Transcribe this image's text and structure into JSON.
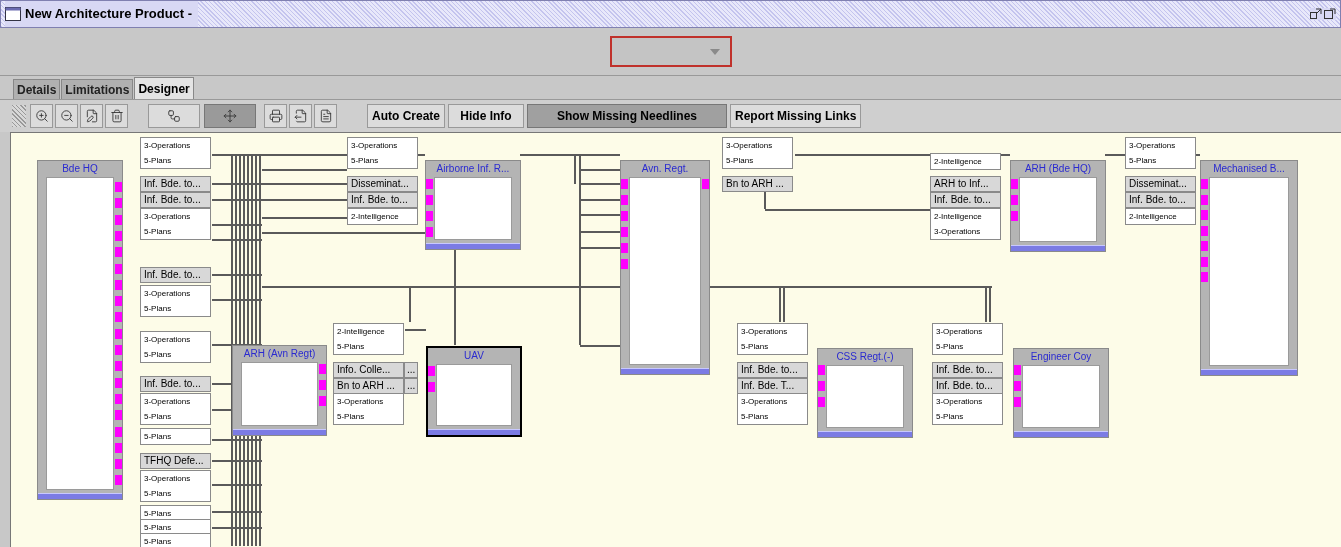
{
  "window": {
    "title": "New Architecture Product -"
  },
  "tabs": [
    {
      "label": "Details",
      "selected": false
    },
    {
      "label": "Limitations",
      "selected": false
    },
    {
      "label": "Designer",
      "selected": true
    }
  ],
  "tools": [
    {
      "kind": "zoom-in",
      "pressed": false
    },
    {
      "kind": "zoom-out",
      "pressed": false
    },
    {
      "kind": "edit",
      "pressed": false
    },
    {
      "kind": "delete",
      "pressed": false
    },
    {
      "kind": "connect",
      "pressed": false
    },
    {
      "kind": "move",
      "pressed": true
    },
    {
      "kind": "print",
      "pressed": false
    },
    {
      "kind": "print-preview",
      "pressed": false
    },
    {
      "kind": "print-setup",
      "pressed": false
    }
  ],
  "buttons": [
    {
      "label": "Auto Create",
      "pressed": false
    },
    {
      "label": "Hide Info",
      "pressed": false
    },
    {
      "label": "Show Missing Needlines",
      "pressed": true
    },
    {
      "label": "Report Missing Links",
      "pressed": false
    }
  ],
  "nodes": [
    {
      "title": "Bde HQ",
      "selected": false
    },
    {
      "title": "Airborne Inf. R...",
      "selected": false
    },
    {
      "title": "Avn. Regt.",
      "selected": false
    },
    {
      "title": "ARH (Bde HQ)",
      "selected": false
    },
    {
      "title": "Mechanised B...",
      "selected": false
    },
    {
      "title": "ARH (Avn Regt)",
      "selected": false
    },
    {
      "title": "UAV",
      "selected": true
    },
    {
      "title": "CSS Regt.(-)",
      "selected": false
    },
    {
      "title": "Engineer Coy",
      "selected": false
    }
  ],
  "labels": [
    {
      "kind": "note",
      "lines": [
        "3-Operations",
        "5-Plans"
      ]
    },
    {
      "kind": "link",
      "text": "Inf. Bde. to..."
    },
    {
      "kind": "link",
      "text": "Inf. Bde. to..."
    },
    {
      "kind": "note",
      "lines": [
        "3-Operations",
        "5-Plans"
      ]
    },
    {
      "kind": "link",
      "text": "Inf. Bde. to..."
    },
    {
      "kind": "note",
      "lines": [
        "3-Operations",
        "5-Plans"
      ]
    },
    {
      "kind": "note",
      "lines": [
        "3-Operations",
        "5-Plans"
      ]
    },
    {
      "kind": "link",
      "text": "Inf. Bde. to..."
    },
    {
      "kind": "note",
      "lines": [
        "3-Operations",
        "5-Plans"
      ]
    },
    {
      "kind": "note",
      "lines": [
        "5-Plans"
      ]
    },
    {
      "kind": "link",
      "text": "TFHQ Defe..."
    },
    {
      "kind": "note",
      "lines": [
        "3-Operations",
        "5-Plans"
      ]
    },
    {
      "kind": "note",
      "lines": [
        "5-Plans"
      ]
    },
    {
      "kind": "note",
      "lines": [
        "5-Plans"
      ]
    },
    {
      "kind": "note",
      "lines": [
        "5-Plans"
      ]
    },
    {
      "kind": "note",
      "lines": [
        "3-Operations",
        "5-Plans"
      ]
    },
    {
      "kind": "link",
      "text": "Disseminat..."
    },
    {
      "kind": "link",
      "text": "Inf. Bde. to..."
    },
    {
      "kind": "note",
      "lines": [
        "2-Intelligence"
      ]
    },
    {
      "kind": "note",
      "lines": [
        "2-Intelligence",
        "5-Plans"
      ]
    },
    {
      "kind": "link",
      "text": "Info. Colle...",
      "suffix": "..."
    },
    {
      "kind": "link",
      "text": "Bn to ARH ...",
      "suffix": "..."
    },
    {
      "kind": "note",
      "lines": [
        "3-Operations",
        "5-Plans"
      ]
    },
    {
      "kind": "note",
      "lines": [
        "3-Operations",
        "5-Plans"
      ]
    },
    {
      "kind": "link",
      "text": "Bn to ARH ..."
    },
    {
      "kind": "note",
      "lines": [
        "2-Intelligence"
      ]
    },
    {
      "kind": "link",
      "text": "ARH to Inf..."
    },
    {
      "kind": "link",
      "text": "Inf. Bde. to..."
    },
    {
      "kind": "note",
      "lines": [
        "2-Intelligence",
        "3-Operations"
      ]
    },
    {
      "kind": "note",
      "lines": [
        "3-Operations",
        "5-Plans"
      ]
    },
    {
      "kind": "link",
      "text": "Disseminat..."
    },
    {
      "kind": "link",
      "text": "Inf. Bde. to..."
    },
    {
      "kind": "note",
      "lines": [
        "2-Intelligence"
      ]
    },
    {
      "kind": "note",
      "lines": [
        "3-Operations",
        "5-Plans"
      ]
    },
    {
      "kind": "link",
      "text": "Inf. Bde. to..."
    },
    {
      "kind": "link",
      "text": "Inf. Bde. T..."
    },
    {
      "kind": "note",
      "lines": [
        "3-Operations",
        "5-Plans"
      ]
    },
    {
      "kind": "note",
      "lines": [
        "3-Operations",
        "5-Plans"
      ]
    },
    {
      "kind": "link",
      "text": "Inf. Bde. to..."
    },
    {
      "kind": "link",
      "text": "Inf. Bde. to..."
    },
    {
      "kind": "note",
      "lines": [
        "3-Operations",
        "5-Plans"
      ]
    }
  ]
}
